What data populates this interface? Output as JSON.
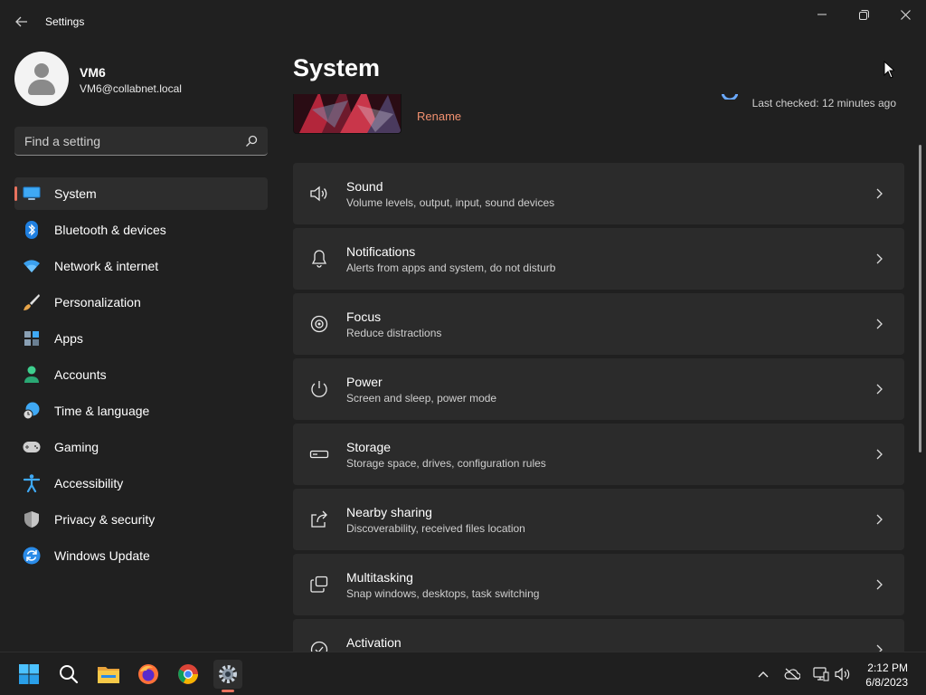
{
  "window": {
    "title": "Settings"
  },
  "profile": {
    "name": "VM6",
    "email": "VM6@collabnet.local"
  },
  "search": {
    "placeholder": "Find a setting"
  },
  "sidebar": {
    "items": [
      {
        "label": "System",
        "icon": "monitor-icon",
        "active": true
      },
      {
        "label": "Bluetooth & devices",
        "icon": "bluetooth-icon"
      },
      {
        "label": "Network & internet",
        "icon": "wifi-icon"
      },
      {
        "label": "Personalization",
        "icon": "brush-icon"
      },
      {
        "label": "Apps",
        "icon": "apps-icon"
      },
      {
        "label": "Accounts",
        "icon": "accounts-icon"
      },
      {
        "label": "Time & language",
        "icon": "globe-clock-icon"
      },
      {
        "label": "Gaming",
        "icon": "gamepad-icon"
      },
      {
        "label": "Accessibility",
        "icon": "accessibility-icon"
      },
      {
        "label": "Privacy & security",
        "icon": "shield-icon"
      },
      {
        "label": "Windows Update",
        "icon": "update-icon"
      }
    ]
  },
  "main": {
    "title": "System",
    "device": {
      "rename_label": "Rename"
    },
    "update_status": "Last checked: 12 minutes ago",
    "cards": [
      {
        "title": "Sound",
        "subtitle": "Volume levels, output, input, sound devices",
        "icon": "speaker-icon"
      },
      {
        "title": "Notifications",
        "subtitle": "Alerts from apps and system, do not disturb",
        "icon": "bell-icon"
      },
      {
        "title": "Focus",
        "subtitle": "Reduce distractions",
        "icon": "focus-icon"
      },
      {
        "title": "Power",
        "subtitle": "Screen and sleep, power mode",
        "icon": "power-icon"
      },
      {
        "title": "Storage",
        "subtitle": "Storage space, drives, configuration rules",
        "icon": "storage-icon"
      },
      {
        "title": "Nearby sharing",
        "subtitle": "Discoverability, received files location",
        "icon": "share-icon"
      },
      {
        "title": "Multitasking",
        "subtitle": "Snap windows, desktops, task switching",
        "icon": "multitasking-icon"
      },
      {
        "title": "Activation",
        "subtitle": "",
        "icon": "activation-icon"
      }
    ]
  },
  "taskbar": {
    "apps": [
      "start-icon",
      "search-icon",
      "file-explorer-icon",
      "firefox-icon",
      "chrome-icon",
      "settings-gear-icon"
    ],
    "tray": [
      "chevron-up-icon",
      "onedrive-offline-icon",
      "network-icon",
      "volume-icon"
    ],
    "time": "2:12 PM",
    "date": "6/8/2023"
  },
  "colors": {
    "accent": "#e8725e",
    "background": "#202020",
    "card": "#2b2b2b",
    "link": "#f0906f"
  }
}
